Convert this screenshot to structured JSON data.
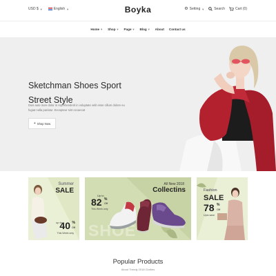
{
  "topbar": {
    "currency": "USD $",
    "language": "English",
    "logo": "Boyka",
    "setting": "Setting",
    "search": "Search",
    "cart": "Cart (0)"
  },
  "nav": {
    "items": [
      {
        "label": "Home"
      },
      {
        "label": "Shop"
      },
      {
        "label": "Page"
      },
      {
        "label": "Blog"
      },
      {
        "label": "About"
      },
      {
        "label": "Contact us"
      }
    ]
  },
  "hero": {
    "title_line1": "Sketchman Shoes Sport",
    "title_line2": "Street Style",
    "desc": "Duis aute irure dolor in reprehenderit in voluptate velit esse cillum dolore eu fugiat nulla pariatur. Excepteur sint occaecat",
    "button": "Shop Now"
  },
  "banners": {
    "left": {
      "line1": "Summer",
      "line2": "SALE",
      "up_to": "up to",
      "percent": "40",
      "pct_sign": "%",
      "off": "Off",
      "note": "This Week only"
    },
    "center": {
      "top": "All New 2018",
      "title": "Collectins",
      "up_to": "Up to",
      "percent": "82",
      "pct_sign": "%",
      "off": "Off",
      "note": "This Week only",
      "bg_word": "SHOE"
    },
    "right": {
      "line1": "Fashion",
      "line2": "SALE",
      "percent": "78",
      "pct_sign": "%",
      "off": "Off",
      "note": "Upto save"
    }
  },
  "popular": {
    "title": "Popular Products",
    "subtitle": "About Trendy 2018 Clothes"
  },
  "colors": {
    "hero_bg": "#efefef",
    "banner_light": "#dfe7c5",
    "banner_mid": "#c7d3a4",
    "jacket": "#b3212f"
  }
}
